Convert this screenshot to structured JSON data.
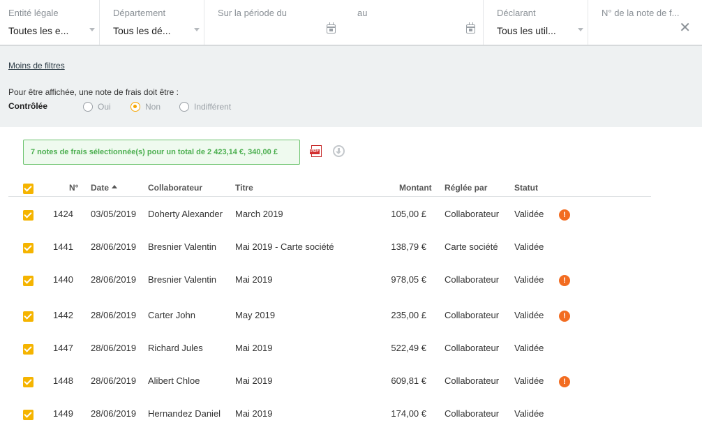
{
  "filters": {
    "legal_entity": {
      "label": "Entité légale",
      "value": "Toutes les e..."
    },
    "department": {
      "label": "Département",
      "value": "Tous les dé..."
    },
    "period": {
      "label_from": "Sur la période du",
      "label_to": "au"
    },
    "declarant": {
      "label": "Déclarant",
      "value": "Tous les util..."
    },
    "note_number": {
      "label": "N° de la note de f..."
    }
  },
  "extended_filters": {
    "less_filters_link": "Moins de filtres",
    "condition_text": "Pour être affichée, une note de frais doit être :",
    "controlled_label": "Contrôlée",
    "options": [
      {
        "label": "Oui",
        "selected": false
      },
      {
        "label": "Non",
        "selected": true
      },
      {
        "label": "Indifférent",
        "selected": false
      }
    ]
  },
  "summary": {
    "text": "7 notes de frais sélectionnée(s) pour un total de 2 423,14 €, 340,00 £",
    "pdf_icon_text": "PDF"
  },
  "table": {
    "headers": {
      "number": "N°",
      "date": "Date",
      "collaborator": "Collaborateur",
      "title": "Titre",
      "amount": "Montant",
      "paid_by": "Réglée par",
      "status": "Statut"
    },
    "rows": [
      {
        "number": "1424",
        "date": "03/05/2019",
        "collaborator": "Doherty Alexander",
        "title": "March 2019",
        "amount": "105,00 £",
        "paid_by": "Collaborateur",
        "status": "Validée",
        "warning": "!"
      },
      {
        "number": "1441",
        "date": "28/06/2019",
        "collaborator": "Bresnier Valentin",
        "title": "Mai 2019 - Carte société",
        "amount": "138,79 €",
        "paid_by": "Carte société",
        "status": "Validée",
        "warning": null
      },
      {
        "number": "1440",
        "date": "28/06/2019",
        "collaborator": "Bresnier Valentin",
        "title": "Mai 2019",
        "amount": "978,05 €",
        "paid_by": "Collaborateur",
        "status": "Validée",
        "warning": "!"
      },
      {
        "number": "1442",
        "date": "28/06/2019",
        "collaborator": "Carter John",
        "title": "May 2019",
        "amount": "235,00 £",
        "paid_by": "Collaborateur",
        "status": "Validée",
        "warning": "!"
      },
      {
        "number": "1447",
        "date": "28/06/2019",
        "collaborator": "Richard Jules",
        "title": "Mai 2019",
        "amount": "522,49 €",
        "paid_by": "Collaborateur",
        "status": "Validée",
        "warning": null
      },
      {
        "number": "1448",
        "date": "28/06/2019",
        "collaborator": "Alibert Chloe",
        "title": "Mai 2019",
        "amount": "609,81 €",
        "paid_by": "Collaborateur",
        "status": "Validée",
        "warning": "!"
      },
      {
        "number": "1449",
        "date": "28/06/2019",
        "collaborator": "Hernandez Daniel",
        "title": "Mai 2019",
        "amount": "174,00 €",
        "paid_by": "Collaborateur",
        "status": "Validée",
        "warning": null
      }
    ]
  },
  "colors": {
    "accent": "#f5b400",
    "warning": "#f26c21",
    "summary_green": "#4caf50"
  }
}
